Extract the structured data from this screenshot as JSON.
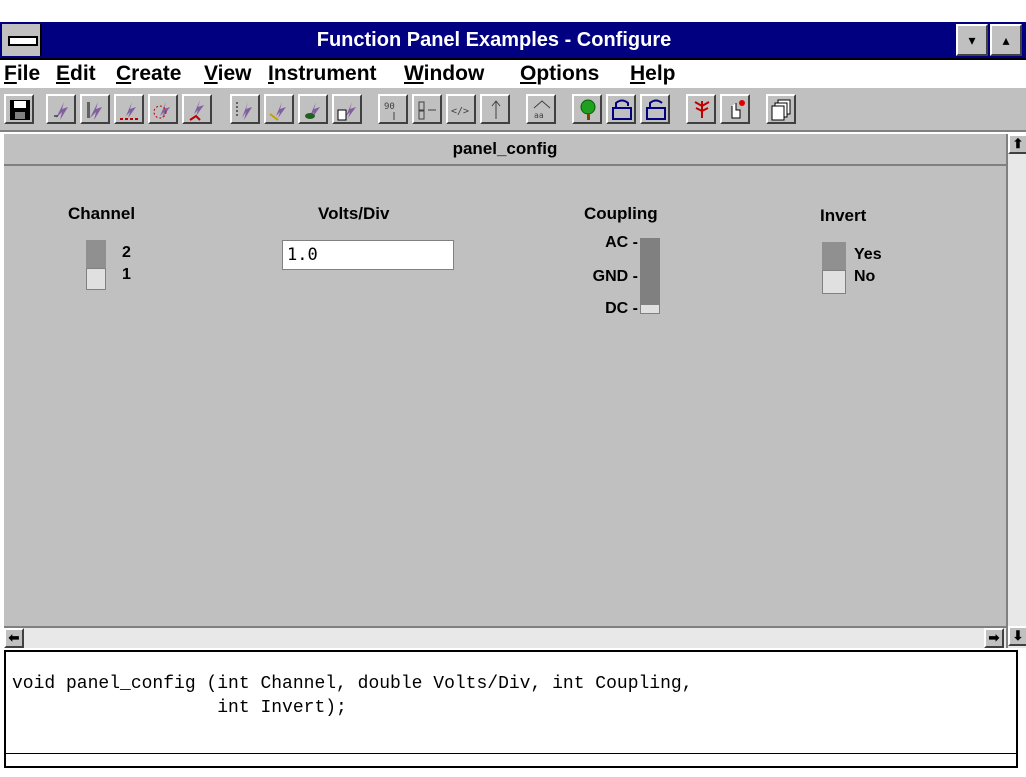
{
  "window": {
    "title": "Function Panel Examples - Configure",
    "minimize_glyph": "▾",
    "maximize_glyph": "▴"
  },
  "menu": [
    {
      "label": "File",
      "accel": "F",
      "rest": "ile"
    },
    {
      "label": "Edit",
      "accel": "E",
      "rest": "dit"
    },
    {
      "label": "Create",
      "accel": "C",
      "rest": "reate"
    },
    {
      "label": "View",
      "accel": "V",
      "rest": "iew"
    },
    {
      "label": "Instrument",
      "accel": "I",
      "rest": "nstrument"
    },
    {
      "label": "Window",
      "accel": "W",
      "rest": "indow"
    },
    {
      "label": "Options",
      "accel": "O",
      "rest": "ptions"
    },
    {
      "label": "Help",
      "accel": "H",
      "rest": "elp"
    }
  ],
  "toolbar": {
    "buttons": [
      "save-icon",
      "control-numeric-icon",
      "control-slide-icon",
      "control-ring-icon",
      "control-binary-icon",
      "control-indicator-icon",
      "control-input-icon",
      "control-return-icon",
      "control-global-icon",
      "control-message-icon",
      "view-connections-icon",
      "view-code-icon",
      "view-tree-icon",
      "view-attributes-icon",
      "tree-icon",
      "lock-icon",
      "unlock-icon",
      "tree-view-icon",
      "hand-pointer-icon",
      "copy-pages-icon"
    ]
  },
  "panel": {
    "title": "panel_config",
    "channel": {
      "label": "Channel",
      "options": [
        "2",
        "1"
      ],
      "selected": "1"
    },
    "volts": {
      "label": "Volts/Div",
      "value": "1.0"
    },
    "coupling": {
      "label": "Coupling",
      "options": [
        "AC -",
        "GND -",
        "DC -"
      ],
      "selected": "DC"
    },
    "invert": {
      "label": "Invert",
      "options": [
        "Yes",
        "No"
      ],
      "selected": "No"
    }
  },
  "scroll": {
    "up": "⬆",
    "down": "⬇",
    "left": "⬅",
    "right": "➡"
  },
  "code": {
    "line1": "void panel_config (int Channel, double Volts/Div, int Coupling,",
    "line2": "                   int Invert);"
  }
}
